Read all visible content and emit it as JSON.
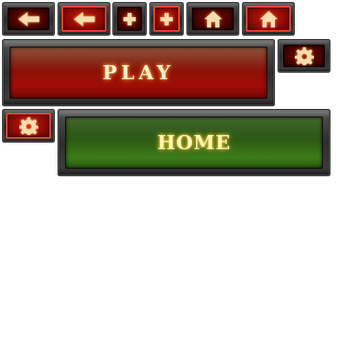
{
  "buttons": {
    "play": {
      "label": "PLAY"
    },
    "home": {
      "label": "HOME"
    }
  },
  "icons": {
    "back": "arrow-left-icon",
    "add": "plus-icon",
    "home": "home-icon",
    "settings": "gear-icon"
  },
  "colors": {
    "glyph": "#f7dcb0",
    "red_frame": "#8e0c04",
    "red_highlight": "#ff3b1f",
    "green_frame": "#3d7c1a",
    "metal": "#3a3a3a"
  }
}
